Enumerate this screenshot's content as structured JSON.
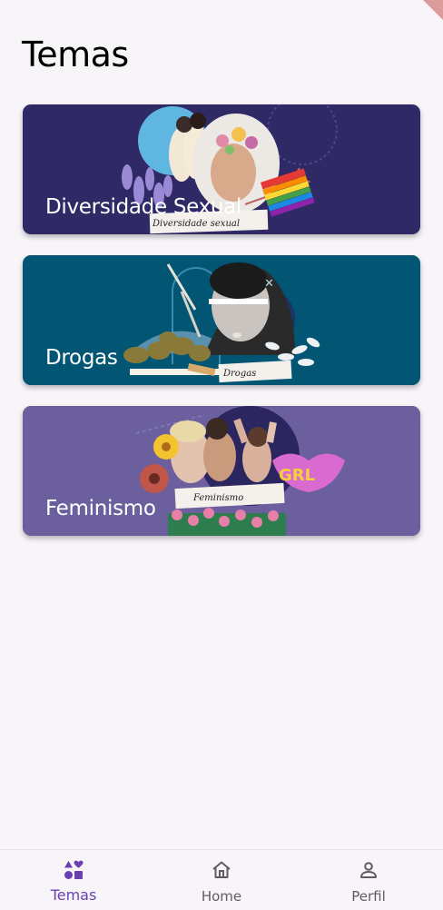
{
  "header": {
    "title": "Temas"
  },
  "topics": [
    {
      "label": "Diversidade Sexual",
      "caption": "Diversidade sexual",
      "color": "#2f2a66"
    },
    {
      "label": "Drogas",
      "caption": "Drogas",
      "color": "#035574"
    },
    {
      "label": "Feminismo",
      "caption": "Feminismo",
      "color": "#6b5f9e"
    }
  ],
  "nav": {
    "items": [
      {
        "label": "Temas",
        "icon": "categories-icon",
        "active": true
      },
      {
        "label": "Home",
        "icon": "home-icon",
        "active": false
      },
      {
        "label": "Perfil",
        "icon": "person-icon",
        "active": false
      }
    ],
    "active_color": "#6a3fb0"
  }
}
